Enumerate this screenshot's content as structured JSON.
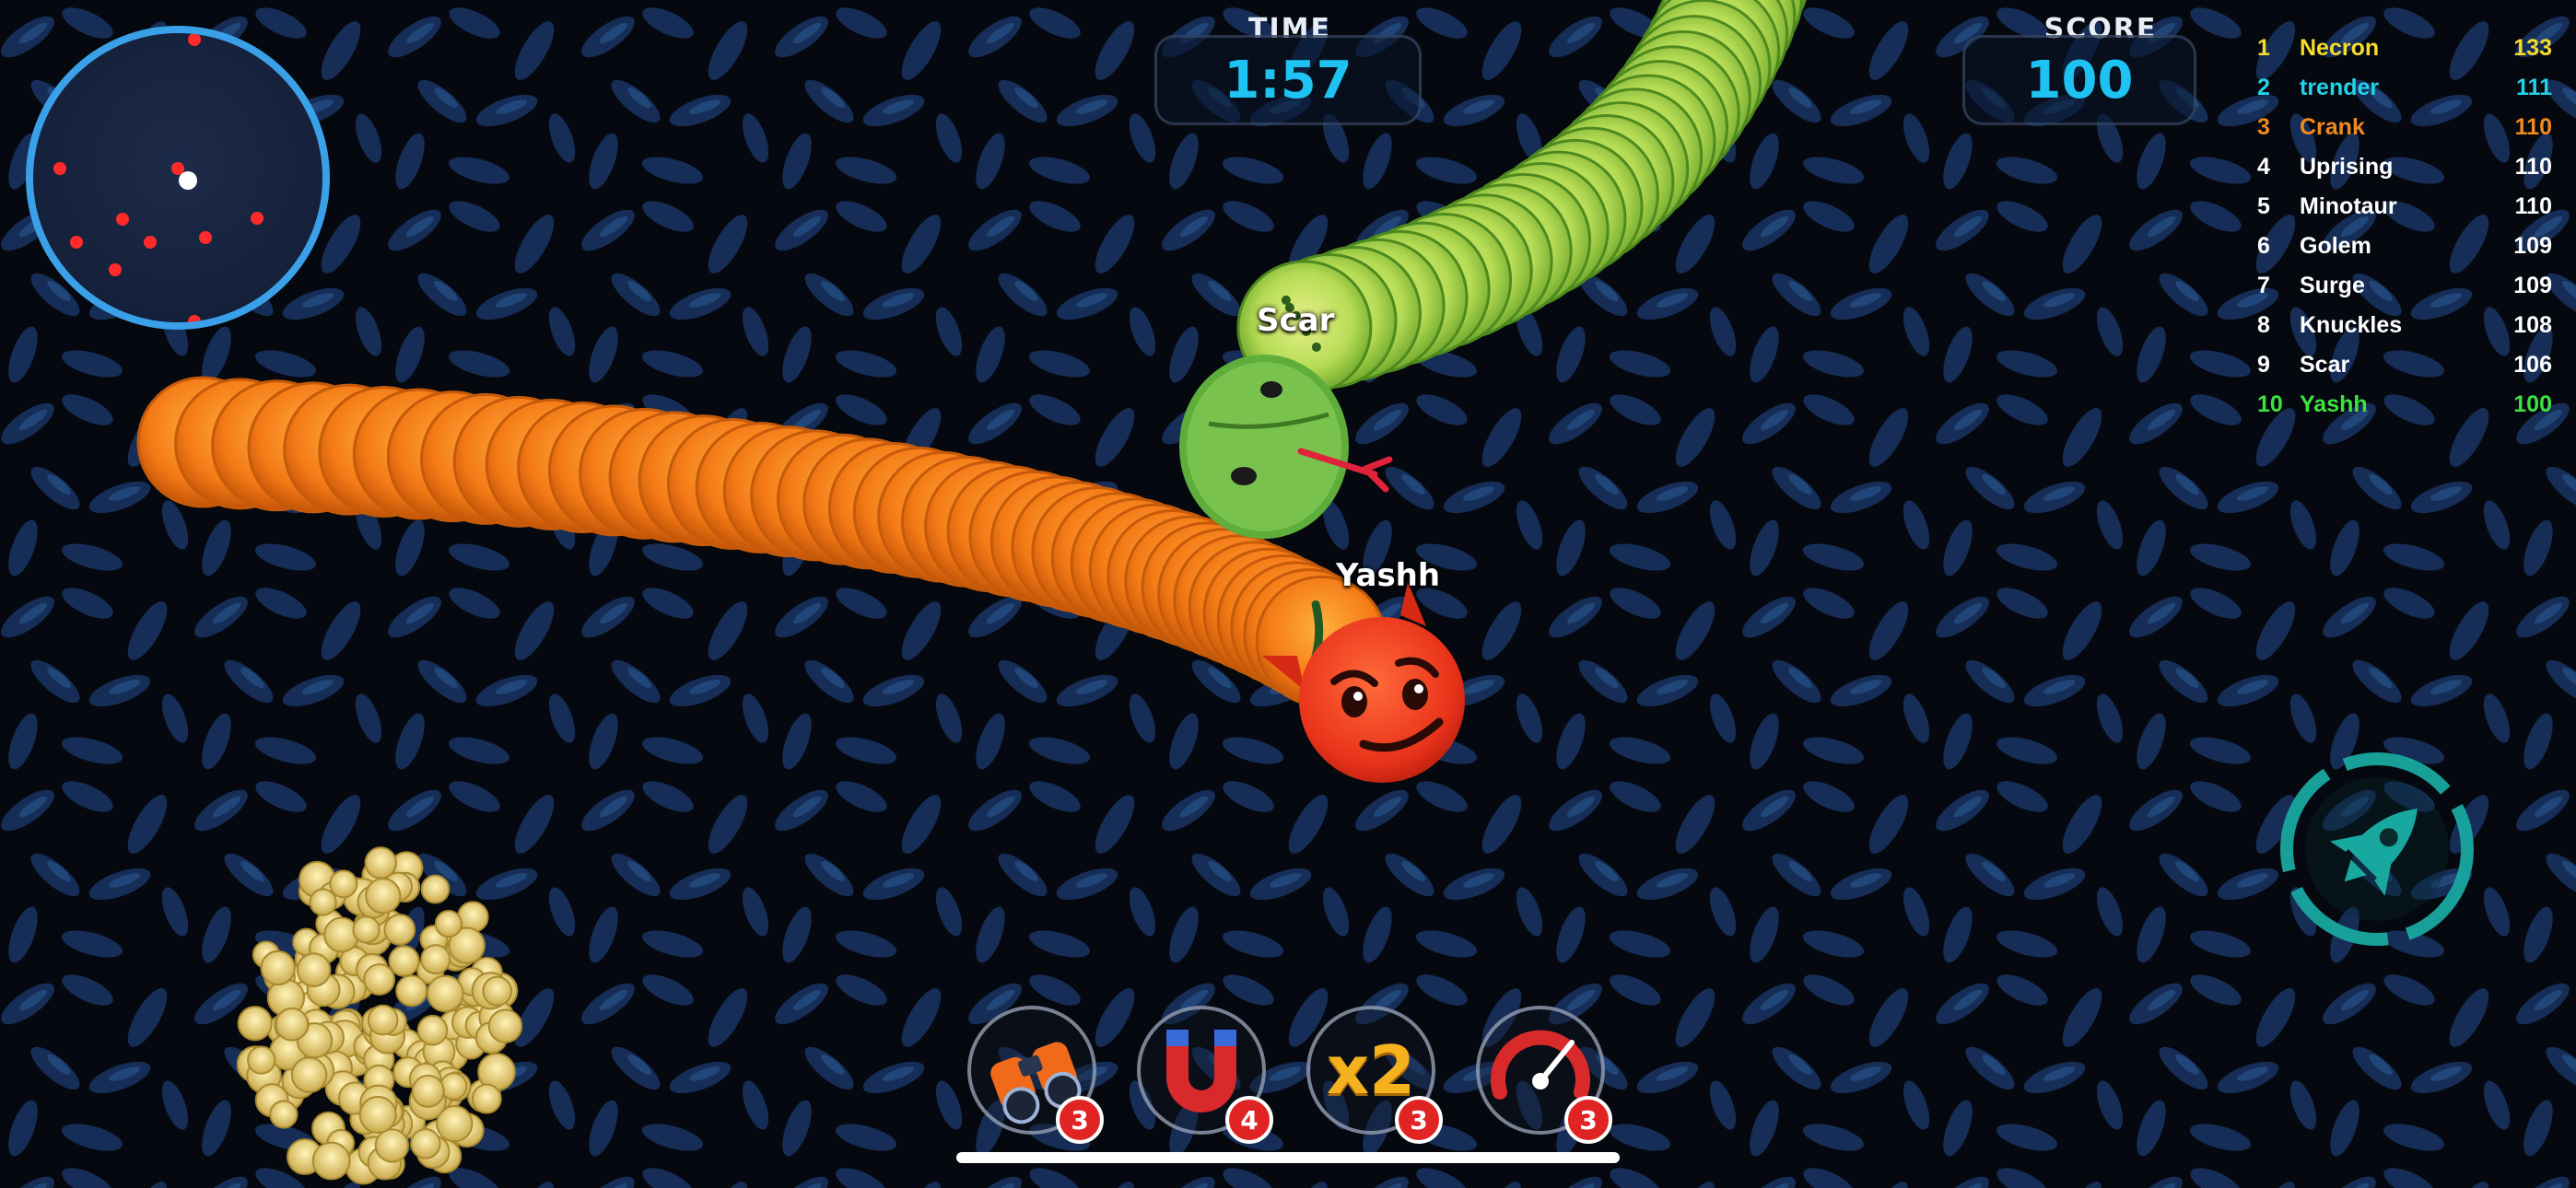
{
  "hud": {
    "time_label": "TIME",
    "time_value": "1:57",
    "score_label": "SCORE",
    "score_value": "100"
  },
  "players": {
    "enemy_name": "Scar",
    "self_name": "Yashh"
  },
  "leaderboard": [
    {
      "rank": "1",
      "name": "Necron",
      "score": "133",
      "color": "#f5dc2a"
    },
    {
      "rank": "2",
      "name": "trender",
      "score": "111",
      "color": "#22d3e8"
    },
    {
      "rank": "3",
      "name": "Crank",
      "score": "110",
      "color": "#f08a1e"
    },
    {
      "rank": "4",
      "name": "Uprising",
      "score": "110",
      "color": "#ffffff"
    },
    {
      "rank": "5",
      "name": "Minotaur",
      "score": "110",
      "color": "#ffffff"
    },
    {
      "rank": "6",
      "name": "Golem",
      "score": "109",
      "color": "#ffffff"
    },
    {
      "rank": "7",
      "name": "Surge",
      "score": "109",
      "color": "#ffffff"
    },
    {
      "rank": "8",
      "name": "Knuckles",
      "score": "108",
      "color": "#ffffff"
    },
    {
      "rank": "9",
      "name": "Scar",
      "score": "106",
      "color": "#ffffff"
    },
    {
      "rank": "10",
      "name": "Yashh",
      "score": "100",
      "color": "#3ee23e"
    }
  ],
  "powerups": [
    {
      "icon": "binoculars-icon",
      "count": "3"
    },
    {
      "icon": "magnet-icon",
      "count": "4"
    },
    {
      "icon": "x2-multiplier-icon",
      "label": "x2",
      "count": "3"
    },
    {
      "icon": "speedometer-icon",
      "count": "3"
    }
  ],
  "colors": {
    "accent": "#1ec3f2",
    "minimap_border": "#3aa0e8",
    "self_snake": "#f47a16",
    "enemy_snake": "#8fcc3a",
    "boost": "#18a8a0"
  }
}
